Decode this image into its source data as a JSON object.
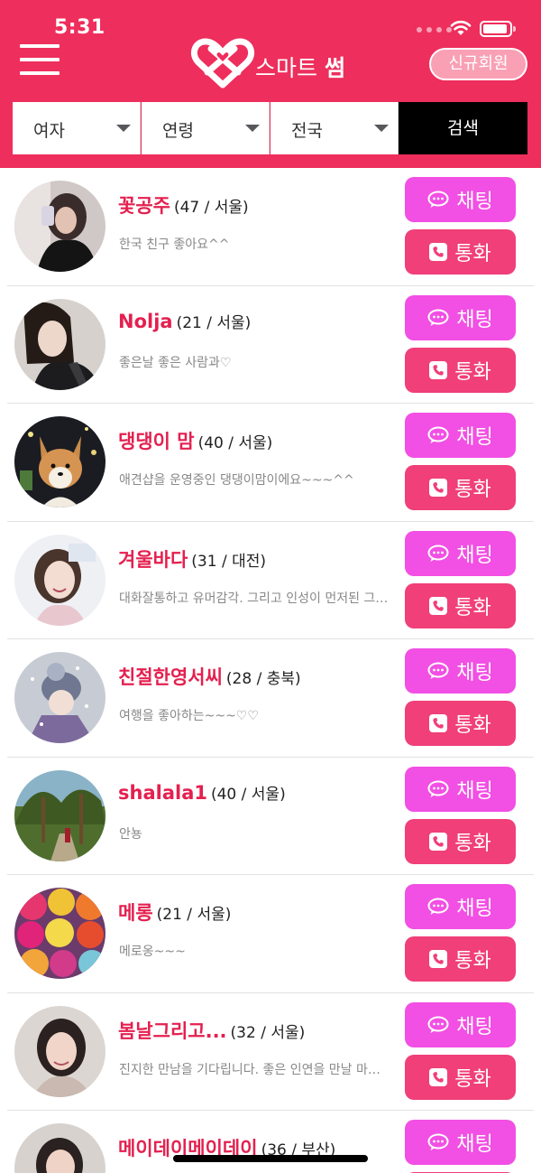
{
  "status_bar": {
    "time": "5:31",
    "icons": [
      "signal-dots-icon",
      "wifi-icon",
      "battery-icon"
    ]
  },
  "header": {
    "menu_icon": "hamburger-menu-icon",
    "logo_icon": "heart-knot-logo-icon",
    "logo_text_prefix": "스마트",
    "logo_text_bold": "썸",
    "signup_label": "신규회원",
    "colors": {
      "background": "#ee2e5c",
      "signup_fill": "#f9a0b5"
    }
  },
  "filters": {
    "gender": "여자",
    "age": "연령",
    "region": "전국",
    "search_label": "검색"
  },
  "buttons": {
    "chat_label": "채팅",
    "call_label": "통화",
    "chat_icon": "speech-bubble-icon",
    "call_icon": "phone-icon",
    "colors": {
      "chat": "#f24fe4",
      "call": "#f03f79"
    }
  },
  "users": [
    {
      "name": "꽃공주",
      "meta": "(47 / 서울)",
      "status": "한국 친구 좋아요^^",
      "avatar": "photo-woman-selfie"
    },
    {
      "name": "Nolja",
      "meta": "(21 / 서울)",
      "status": "좋은날 좋은 사람과♡",
      "avatar": "photo-woman-leather-jacket"
    },
    {
      "name": "댕댕이 맘",
      "meta": "(40 / 서울)",
      "status": "애견샵을 운영중인 댕댕이맘이에요~~~^^",
      "avatar": "photo-corgi-dog"
    },
    {
      "name": "겨울바다",
      "meta": "(31 / 대전)",
      "status": "대화잘통하고 유머감각. 그리고 인성이 먼저된 그…",
      "avatar": "photo-woman-smiling"
    },
    {
      "name": "친절한영서씨",
      "meta": "(28 / 충북)",
      "status": "여행을 좋아하는~~~♡♡",
      "avatar": "photo-woman-snow-hat"
    },
    {
      "name": "shalala1",
      "meta": "(40 / 서울)",
      "status": "안뇽",
      "avatar": "photo-tropical-garden"
    },
    {
      "name": "메롱",
      "meta": "(21 / 서울)",
      "status": "메로옹~~~",
      "avatar": "photo-yarn-balls"
    },
    {
      "name": "봄날그리고...",
      "meta": "(32 / 서울)",
      "status": "진지한 만남을 기다립니다. 좋은 인연을 만날 마…",
      "avatar": "photo-woman-portrait"
    },
    {
      "name": "메이데이메이데이",
      "meta": "(36 / 부산)",
      "status": "",
      "avatar": "photo-woman-portrait-2"
    }
  ]
}
